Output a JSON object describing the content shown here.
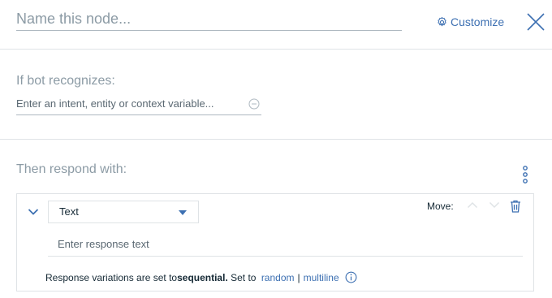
{
  "header": {
    "node_name_placeholder": "Name this node...",
    "customize_label": "Customize"
  },
  "condition": {
    "label": "If bot recognizes:",
    "placeholder": "Enter an intent, entity or context variable..."
  },
  "response": {
    "label": "Then respond with:",
    "type_value": "Text",
    "move_label": "Move:",
    "text_placeholder": "Enter response text",
    "variation": {
      "prefix": "Response variations are set to ",
      "mode": "sequential.",
      "set_to": " Set to ",
      "random": "random",
      "separator": "|",
      "multiline": "multiline"
    }
  },
  "colors": {
    "accent": "#3d70b2",
    "text": "#152935",
    "muted": "#8c9ba5",
    "border": "#dfe3e6"
  }
}
